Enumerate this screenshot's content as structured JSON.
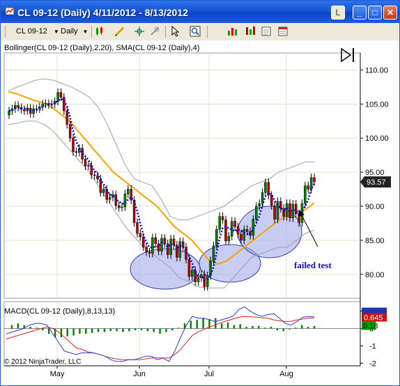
{
  "window": {
    "title": "CL 09-12 (Daily)  4/11/2012 - 8/13/2012",
    "buttons": {
      "link": "L",
      "minimize": "_",
      "maximize": "□",
      "close": "✕"
    }
  },
  "toolbar": {
    "instrument": "CL 09-12",
    "period": "Daily",
    "icons": [
      "chart-style-icon",
      "drawing-tool-icon",
      "crosshair-icon",
      "global-crosshair-icon",
      "pointer-icon",
      "zoom-icon",
      "strategy-icon",
      "indicator-icon",
      "data-box-icon",
      "properties-icon"
    ]
  },
  "price_panel": {
    "indicator_title": "Bollinger(CL 09-12 (Daily),2,20), SMA(CL 09-12 (Daily),4)",
    "last_price": "93.57",
    "annotation": "failed test",
    "colors": {
      "up_candle": "#008000",
      "down_candle": "#c00000",
      "bollinger": "#a0a0a0",
      "sma_long": "#f5a300",
      "sma_dots": "#0000dd",
      "ellipse_fill": "#9aa3e8",
      "price_tag": "#222222"
    }
  },
  "macd_panel": {
    "title": "MACD(CL 09-12 (Daily),8,13,13)",
    "values": {
      "macd": "0.645",
      "signal": "0.18"
    },
    "colors": {
      "macd_line": "#2b3ad8",
      "signal_line": "#e02020",
      "histogram": "#008000",
      "macd_tag": "#d01010",
      "signal_tag": "#00a000"
    }
  },
  "copyright": "© 2012 NinjaTrader, LLC",
  "chart_data": [
    {
      "type": "candlestick",
      "title": "Bollinger(CL 09-12 (Daily),2,20), SMA(CL 09-12 (Daily),4)",
      "x_ticks": [
        "May",
        "Jun",
        "Jul",
        "Aug"
      ],
      "y_ticks": [
        "80.00",
        "85.00",
        "90.00",
        "95.00",
        "100.00",
        "105.00",
        "110.00"
      ],
      "ylim": [
        76.5,
        112.5
      ],
      "grid": true,
      "candles_close": [
        104.0,
        104.3,
        104.8,
        104.5,
        104.2,
        104.0,
        104.4,
        103.6,
        104.3,
        104.3,
        104.6,
        105.0,
        105.1,
        104.9,
        105.0,
        105.4,
        106.7,
        106.0,
        104.0,
        102.0,
        100.0,
        98.0,
        97.9,
        98.5,
        96.9,
        95.9,
        96.0,
        94.6,
        94.5,
        94.0,
        92.0,
        92.5,
        91.0,
        91.3,
        91.7,
        90.1,
        89.8,
        89.9,
        91.8,
        92.5,
        90.9,
        87.6,
        86.0,
        85.5,
        84.0,
        83.3,
        83.1,
        85.4,
        84.5,
        83.4,
        85.3,
        84.5,
        82.9,
        85.2,
        84.3,
        82.5,
        84.8,
        84.0,
        82.2,
        79.7,
        80.6,
        78.9,
        79.5,
        80.0,
        78.2,
        79.8,
        82.0,
        84.2,
        86.6,
        88.5,
        88.0,
        84.9,
        85.6,
        87.8,
        87.0,
        85.9,
        85.0,
        86.6,
        86.3,
        85.7,
        88.1,
        90.0,
        90.4,
        92.0,
        93.5,
        91.6,
        90.1,
        88.1,
        90.7,
        89.7,
        88.5,
        90.4,
        88.3,
        90.3,
        88.9,
        87.6,
        90.4,
        93.0,
        92.5,
        94.2,
        93.57
      ],
      "bollinger_upper": [
        107.0,
        107.5,
        108.0,
        108.5,
        108.7,
        108.5,
        108.0,
        107.5,
        106.8,
        106.0,
        104.5,
        102.0,
        99.0,
        96.0,
        94.0,
        93.5,
        93.0,
        91.0,
        88.5,
        88.0,
        88.0,
        88.5,
        89.0,
        89.5,
        90.0,
        91.0,
        92.0,
        93.0,
        93.5,
        94.0,
        95.0,
        95.5,
        96.0,
        96.5,
        96.5
      ],
      "bollinger_lower": [
        102.0,
        102.2,
        102.5,
        102.5,
        102.0,
        101.0,
        99.5,
        98.0,
        96.5,
        95.0,
        93.0,
        91.0,
        89.0,
        87.0,
        85.5,
        84.0,
        83.0,
        82.0,
        81.0,
        79.5,
        79.0,
        78.2,
        78.0,
        78.0,
        78.0,
        79.5,
        81.0,
        82.5,
        83.0,
        83.5,
        84.0,
        84.0,
        85.0,
        86.0,
        86.5
      ],
      "sma_long": [
        106.8,
        106.5,
        106.0,
        105.5,
        105.2,
        104.5,
        103.5,
        102.5,
        101.0,
        99.5,
        98.0,
        96.5,
        95.0,
        94.0,
        93.0,
        92.0,
        91.0,
        90.0,
        88.5,
        87.0,
        86.0,
        85.0,
        83.5,
        82.0,
        81.5,
        82.0,
        83.0,
        84.0,
        85.0,
        86.0,
        87.0,
        88.0,
        88.5,
        89.0,
        89.5,
        90.5
      ],
      "failed_test_arrow": true
    },
    {
      "type": "line",
      "title": "MACD(CL 09-12 (Daily),8,13,13)",
      "y_ticks": [
        "1",
        "0",
        "-1",
        "-2"
      ],
      "ylim": [
        -2.15,
        1.55
      ],
      "macd": [
        -0.3,
        -0.2,
        -0.1,
        0.0,
        0.2,
        0.3,
        0.3,
        0.2,
        -0.3,
        -0.8,
        -1.3,
        -1.4,
        -1.5,
        -1.4,
        -1.4,
        -1.4,
        -1.5,
        -1.6,
        -1.8,
        -1.9,
        -1.9,
        -1.8,
        -1.8,
        -1.7,
        -1.6,
        -1.6,
        -1.8,
        -1.7,
        -1.9,
        -1.3,
        -0.5,
        0.2,
        0.7,
        0.6,
        0.6,
        0.5,
        0.4,
        0.5,
        0.6,
        0.7,
        1.1,
        1.25,
        1.0,
        0.8,
        0.7,
        0.8,
        0.85,
        0.6,
        0.3,
        0.2,
        0.4,
        0.65,
        0.7,
        0.67
      ],
      "signal": [
        -0.6,
        -0.5,
        -0.4,
        -0.3,
        -0.2,
        -0.1,
        0.0,
        0.1,
        0.0,
        -0.2,
        -0.5,
        -0.8,
        -1.1,
        -1.2,
        -1.35,
        -1.4,
        -1.5,
        -1.6,
        -1.7,
        -1.75,
        -1.8,
        -1.8,
        -1.8,
        -1.8,
        -1.75,
        -1.7,
        -1.7,
        -1.7,
        -1.7,
        -1.5,
        -1.2,
        -0.8,
        -0.4,
        -0.2,
        -0.05,
        0.1,
        0.2,
        0.35,
        0.45,
        0.55,
        0.65,
        0.7,
        0.68,
        0.66,
        0.62,
        0.6,
        0.5,
        0.45,
        0.4,
        0.42,
        0.5,
        0.55,
        0.6,
        0.62
      ],
      "histogram": [
        0.2,
        0.3,
        0.2,
        0.1,
        0.05,
        -0.1,
        -0.3,
        -0.5,
        -0.5,
        -0.45,
        -0.4,
        -0.3,
        -0.3,
        -0.25,
        -0.2,
        -0.2,
        -0.15,
        -0.15,
        -0.2,
        -0.15,
        -0.1,
        -0.1,
        -0.15,
        -0.2,
        -0.3,
        -0.2,
        -0.1,
        0.05,
        0.3,
        0.45,
        0.5,
        0.6,
        0.55,
        0.6,
        0.3,
        0.35,
        0.2,
        0.25,
        0.1,
        0.15,
        0.15,
        0.05,
        0.1,
        -0.1,
        -0.15,
        -0.05,
        0.05,
        0.2,
        0.1,
        0.15
      ],
      "x_ticks": [
        "May",
        "Jun",
        "Jul",
        "Aug"
      ]
    }
  ]
}
